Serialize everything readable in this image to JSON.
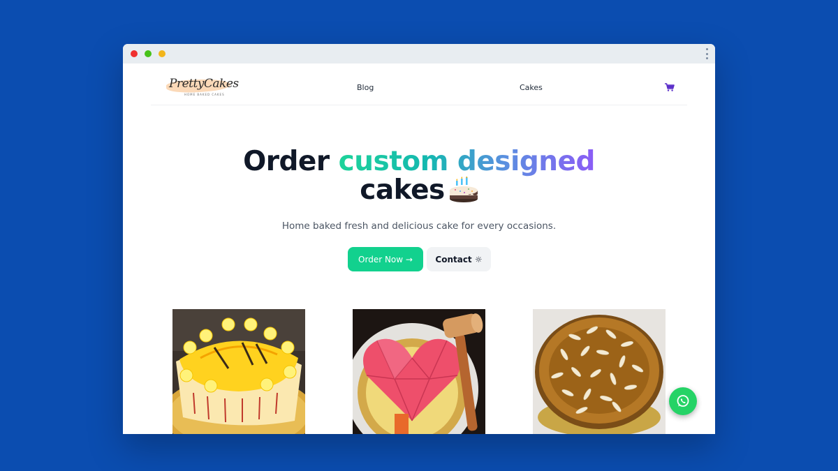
{
  "brand": {
    "logo_text": "PrettyCakes",
    "logo_subtext": "HOME BAKED CAKES"
  },
  "nav": {
    "links": [
      {
        "label": "Blog"
      },
      {
        "label": "Cakes"
      }
    ],
    "cart_icon": "cart-icon"
  },
  "hero": {
    "title_part1": "Order ",
    "title_highlight": "custom designed",
    "title_part2": "cakes",
    "emoji_icon": "birthday-cake-icon",
    "subtitle": "Home baked fresh and delicious cake for every occasions.",
    "order_button": "Order Now →",
    "contact_button": "Contact ☼"
  },
  "gallery": {
    "items": [
      {
        "icon": "yellow-cream-cake-photo"
      },
      {
        "icon": "pink-heart-pinata-cake-photo"
      },
      {
        "icon": "almond-topped-cake-photo"
      }
    ]
  },
  "whatsapp_icon": "whatsapp-icon",
  "colors": {
    "background": "#0b4db0",
    "accent_green": "#12d18e",
    "gradient_start": "#1ed39a",
    "gradient_end": "#8b5cf6",
    "cart": "#5b2fc9",
    "whatsapp": "#25d366"
  }
}
